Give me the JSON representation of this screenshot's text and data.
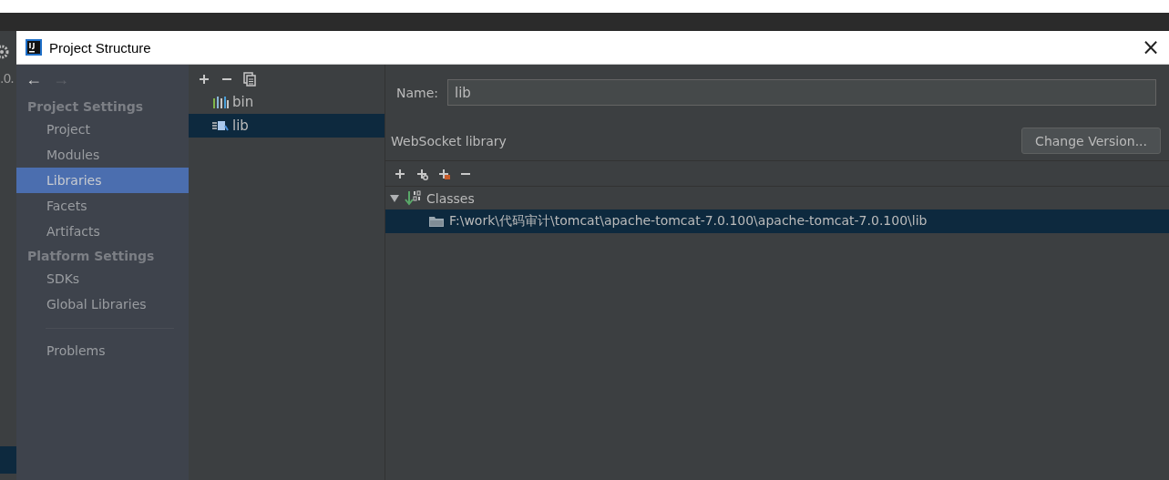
{
  "background_window": {
    "text": ".0."
  },
  "window": {
    "title": "Project Structure",
    "close": "×"
  },
  "sidebar": {
    "nav": [
      "←",
      "→"
    ],
    "sections": [
      {
        "header": "Project Settings",
        "items": [
          {
            "label": "Project",
            "selected": false
          },
          {
            "label": "Modules",
            "selected": false
          },
          {
            "label": "Libraries",
            "selected": true
          },
          {
            "label": "Facets",
            "selected": false
          },
          {
            "label": "Artifacts",
            "selected": false
          }
        ]
      },
      {
        "header": "Platform Settings",
        "items": [
          {
            "label": "SDKs",
            "selected": false
          },
          {
            "label": "Global Libraries",
            "selected": false
          }
        ]
      }
    ],
    "footer_items": [
      {
        "label": "Problems",
        "selected": false
      }
    ]
  },
  "library_list": {
    "items": [
      {
        "label": "bin",
        "kind": "bars",
        "selected": false
      },
      {
        "label": "lib",
        "kind": "jar",
        "selected": true
      }
    ]
  },
  "detail": {
    "name_label": "Name:",
    "name_value": "lib",
    "library_type": "WebSocket library",
    "change_version_button": "Change Version...",
    "tree": [
      {
        "label": "Classes",
        "expanded": true,
        "children": [
          {
            "label": "F:\\work\\代码审计\\tomcat\\apache-tomcat-7.0.100\\apache-tomcat-7.0.100\\lib",
            "selected": true
          }
        ]
      }
    ]
  }
}
